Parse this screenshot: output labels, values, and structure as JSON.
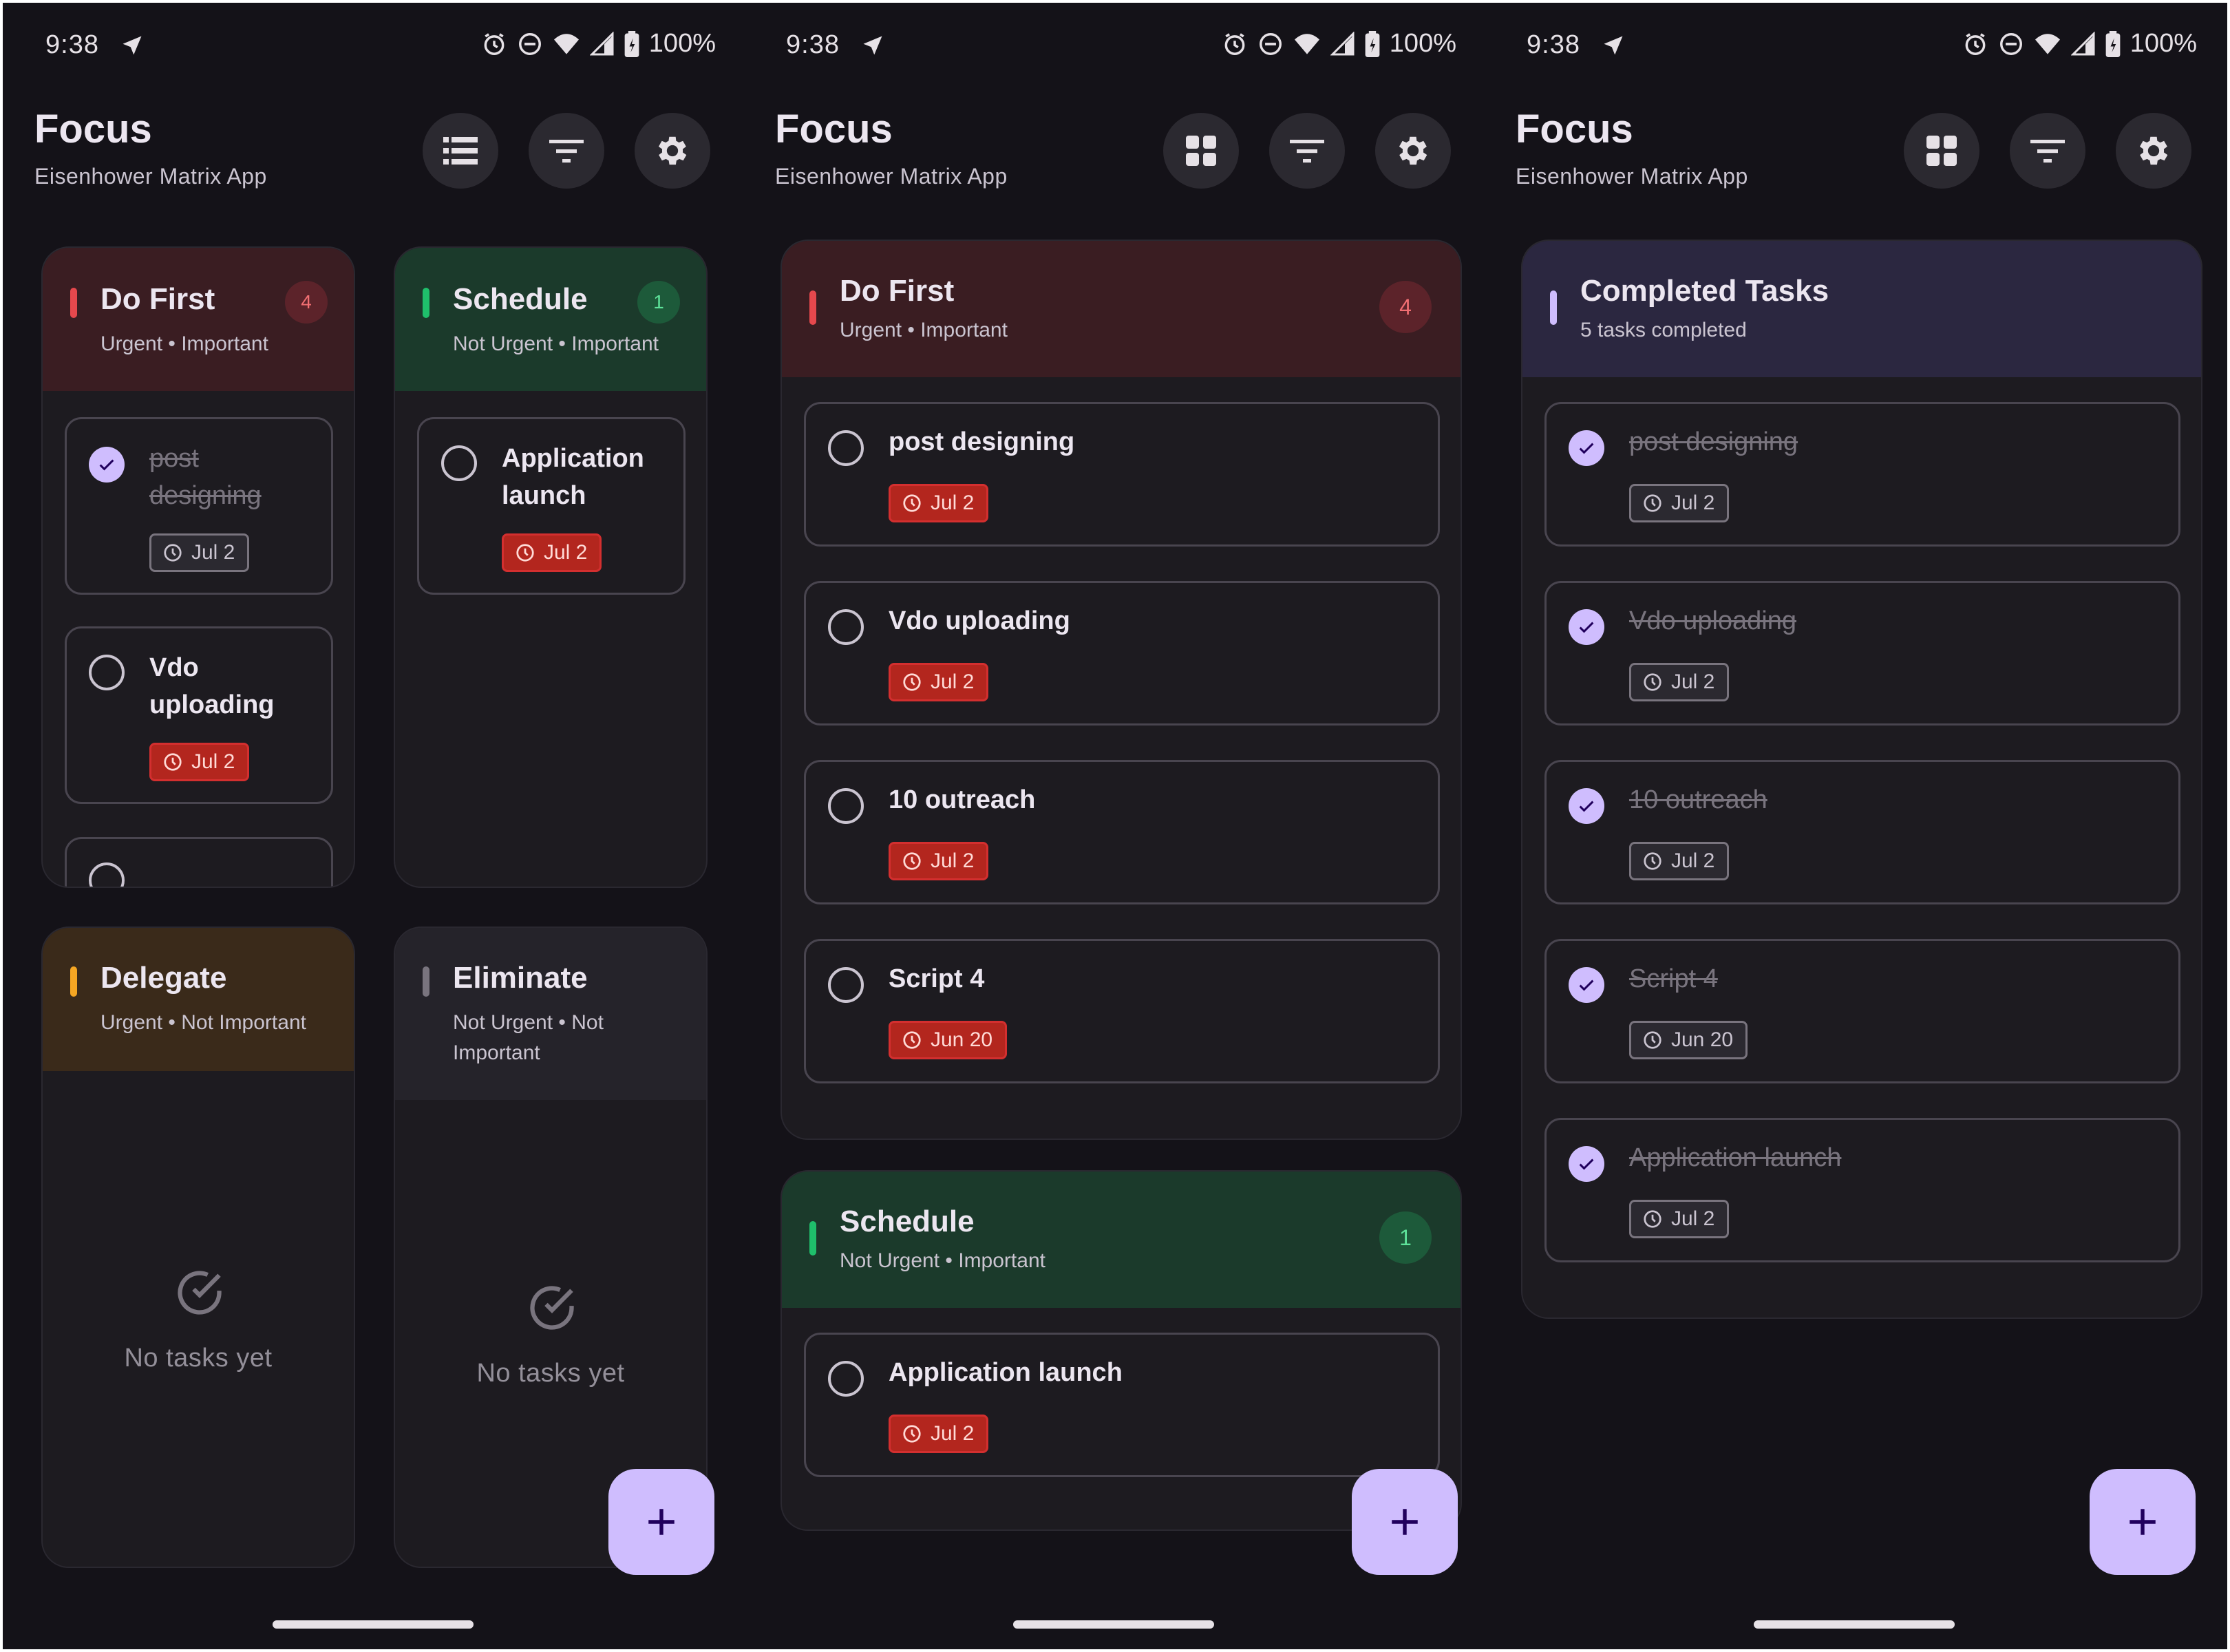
{
  "status": {
    "time": "9:38",
    "battery": "100%"
  },
  "app": {
    "title": "Focus",
    "subtitle": "Eisenhower Matrix App"
  },
  "colors": {
    "bg": "#141218",
    "red": "#e5484d",
    "green": "#1fbf6b",
    "orange": "#f5a623",
    "grey": "#79747e",
    "purple": "#cfbdfe"
  },
  "grid_view": {
    "do_first": {
      "title": "Do First",
      "subtitle": "Urgent • Important",
      "count": "4",
      "tasks": [
        {
          "name": "post designing",
          "date": "Jul 2",
          "done": true
        },
        {
          "name": "Vdo uploading",
          "date": "Jul 2",
          "done": false
        }
      ]
    },
    "schedule": {
      "title": "Schedule",
      "subtitle": "Not Urgent • Important",
      "count": "1",
      "tasks": [
        {
          "name": "Application launch",
          "date": "Jul 2",
          "done": false
        }
      ]
    },
    "delegate": {
      "title": "Delegate",
      "subtitle": "Urgent • Not Important",
      "empty": "No tasks yet"
    },
    "eliminate": {
      "title": "Eliminate",
      "subtitle": "Not Urgent • Not Important",
      "empty": "No tasks yet"
    }
  },
  "list_view": {
    "do_first": {
      "title": "Do First",
      "subtitle": "Urgent • Important",
      "count": "4",
      "tasks": [
        {
          "name": "post designing",
          "date": "Jul 2"
        },
        {
          "name": "Vdo uploading",
          "date": "Jul 2"
        },
        {
          "name": "10 outreach",
          "date": "Jul 2"
        },
        {
          "name": "Script 4",
          "date": "Jun 20"
        }
      ]
    },
    "schedule": {
      "title": "Schedule",
      "subtitle": "Not Urgent • Important",
      "count": "1",
      "tasks": [
        {
          "name": "Application launch",
          "date": "Jul 2"
        }
      ]
    }
  },
  "completed_view": {
    "title": "Completed Tasks",
    "subtitle": "5 tasks completed",
    "tasks": [
      {
        "name": "post designing",
        "date": "Jul 2"
      },
      {
        "name": "Vdo uploading",
        "date": "Jul 2"
      },
      {
        "name": "10 outreach",
        "date": "Jul 2"
      },
      {
        "name": "Script 4",
        "date": "Jun 20"
      },
      {
        "name": "Application launch",
        "date": "Jul 2"
      }
    ]
  }
}
